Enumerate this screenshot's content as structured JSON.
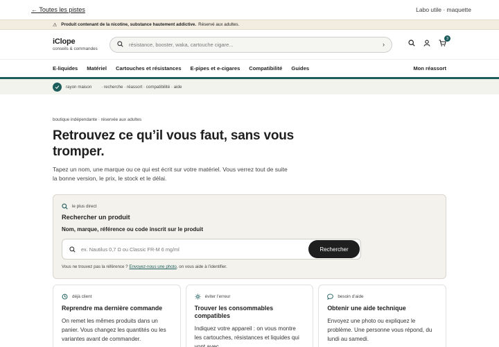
{
  "topbar": {
    "back_link": "← Toutes les pistes",
    "right_label": "Labo utile · maquette"
  },
  "warning": {
    "bold": "Produit contenant de la nicotine, substance hautement addictive.",
    "text": "Réservé aux adultes."
  },
  "header": {
    "logo_name": "iClope",
    "logo_sub": "conseils & commandes",
    "search_placeholder": "résistance, booster, waka, cartouche cigare...",
    "cart_count": "3"
  },
  "nav": {
    "items": [
      "E-liquides",
      "Matériel",
      "Cartouches et résistances",
      "E-pipes et e-cigares",
      "Compatibilité",
      "Guides"
    ],
    "restock": "Mon réassort"
  },
  "crumbs": {
    "first": "rayon maison",
    "rest": "· recherche · réassort · compatibilité · aide"
  },
  "hero": {
    "kicker": "boutique indépendante · réservée aux adultes",
    "title": "Retrouvez ce qu’il vous faut, sans vous tromper.",
    "lead": "Tapez un nom, une marque ou ce qui est écrit sur votre matériel. Vous verrez tout de suite la bonne version, le prix, le stock et le délai."
  },
  "search_card": {
    "tag": "le plus direct",
    "title": "Rechercher un produit",
    "field_label": "Nom, marque, référence ou code inscrit sur le produit",
    "placeholder": "ex. Nautilus 0,7 Ω ou Classic FR-M 6 mg/ml",
    "button": "Rechercher",
    "note_before": "Vous ne trouvez pas la référence ?",
    "note_link": "Envoyez-nous une photo",
    "note_after": ", on vous aide à l’identifier."
  },
  "cards": [
    {
      "tag": "déjà client",
      "title": "Reprendre ma dernière commande",
      "text": "On remet les mêmes produits dans un panier. Vous changez les quantités ou les variantes avant de commander."
    },
    {
      "tag": "éviter l’erreur",
      "title": "Trouver les consommables compatibles",
      "text": "Indiquez votre appareil : on vous montre les cartouches, résistances et liquides qui vont avec."
    },
    {
      "tag": "besoin d’aide",
      "title": "Obtenir une aide technique",
      "text": "Envoyez une photo ou expliquez le problème. Une personne vous répond, du lundi au samedi."
    }
  ],
  "colors": {
    "accent": "#1d5d5c",
    "warning_bg": "#f3ede1",
    "card_bg": "#f3f2ec"
  }
}
